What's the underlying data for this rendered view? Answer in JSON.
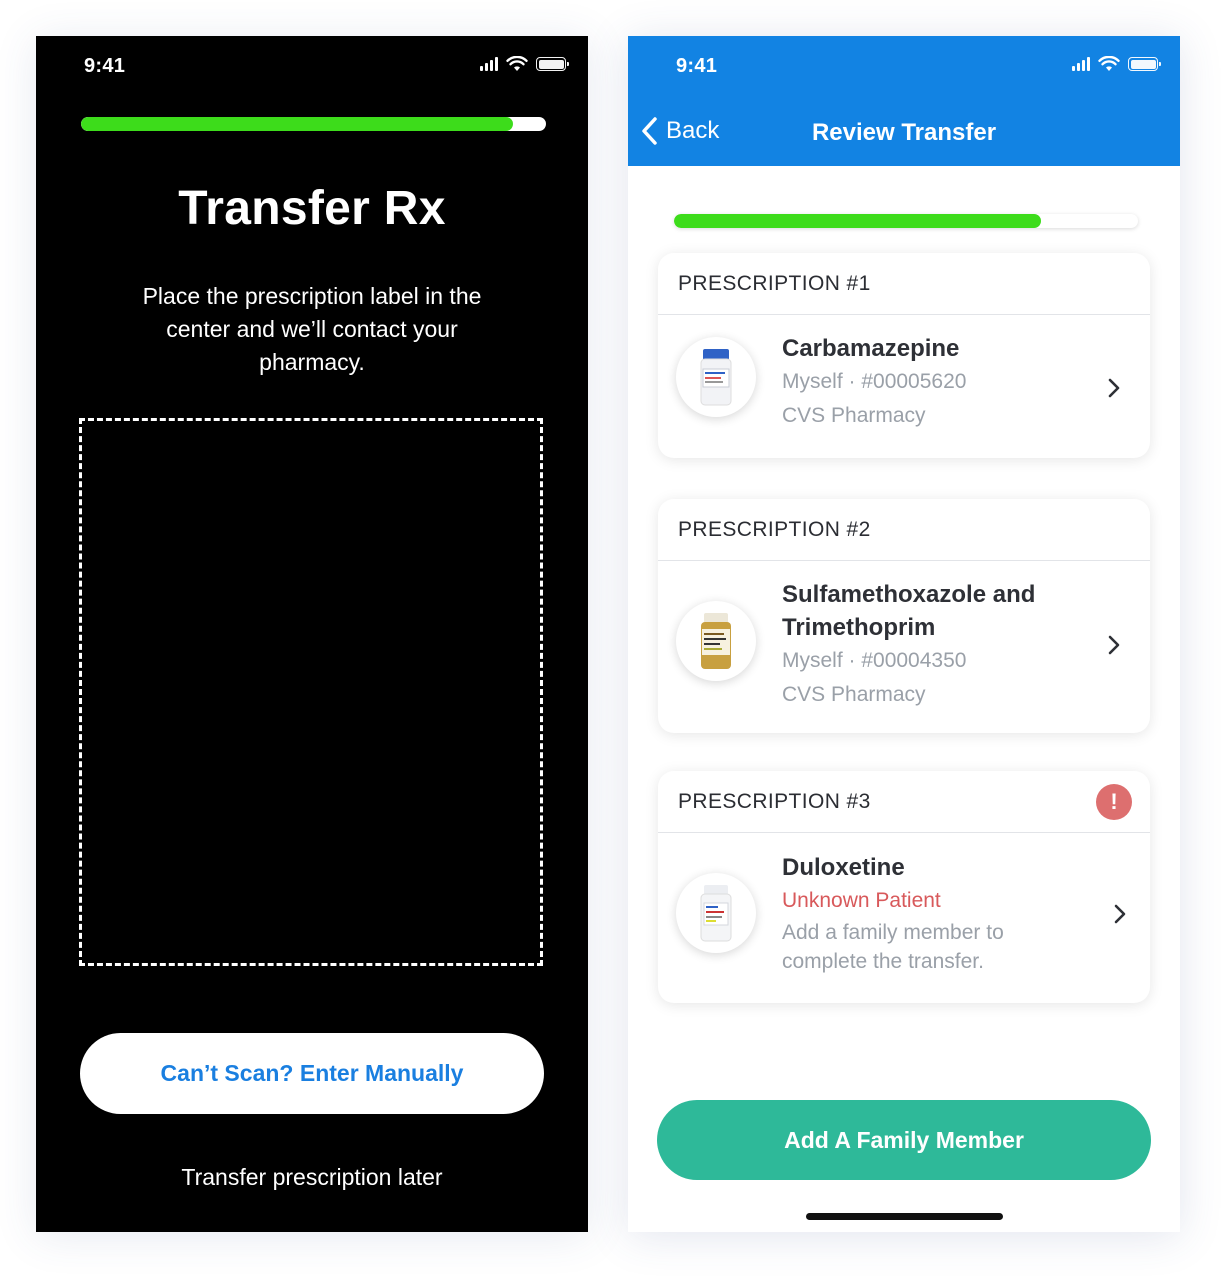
{
  "left_screen": {
    "status_time": "9:41",
    "progress": 0.93,
    "title": "Transfer Rx",
    "instructions": "Place the prescription label in the center and we’ll contact your pharmacy.",
    "manual_button": "Can’t Scan? Enter Manually",
    "later_link": "Transfer prescription later"
  },
  "right_screen": {
    "status_time": "9:41",
    "back_label": "Back",
    "nav_title": "Review Transfer",
    "progress": 0.79,
    "prescriptions": [
      {
        "header": "PRESCRIPTION #1",
        "name": "Carbamazepine",
        "patient_line": "Myself · #00005620",
        "pharmacy": "CVS Pharmacy"
      },
      {
        "header": "PRESCRIPTION #2",
        "name_line1": "Sulfamethoxazole and",
        "name_line2": "Trimethoprim",
        "patient_line": "Myself · #00004350",
        "pharmacy": "CVS Pharmacy"
      },
      {
        "header": "PRESCRIPTION #3",
        "name": "Duloxetine",
        "patient_line": "Unknown Patient",
        "note_line1": "Add a family member to",
        "note_line2": "complete the transfer.",
        "alert_icon": "!"
      }
    ],
    "family_button": "Add A Family Member"
  },
  "colors": {
    "progress_green": "#3ddc1b",
    "nav_blue": "#1283e3",
    "button_teal": "#2eb999",
    "error_red": "#d8595b",
    "link_blue": "#1a7fe0"
  },
  "icons": [
    "signal-icon",
    "wifi-icon",
    "battery-icon",
    "back-chevron-icon",
    "chevron-right-icon",
    "alert-icon",
    "pill-bottle-icon"
  ]
}
